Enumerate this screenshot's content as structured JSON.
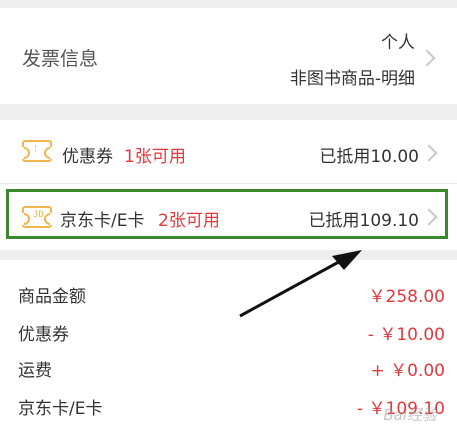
{
  "invoice": {
    "label": "发票信息",
    "type": "个人",
    "detail": "非图书商品-明细"
  },
  "coupon": {
    "label": "优惠券",
    "available": "1张可用",
    "value": "已抵用10.00"
  },
  "card": {
    "icon_text": "JD",
    "label": "京东卡/E卡",
    "available": "2张可用",
    "value": "已抵用109.10"
  },
  "summary": {
    "lines": [
      {
        "label": "商品金额",
        "value": "￥258.00"
      },
      {
        "label": "优惠券",
        "value": "- ￥10.00"
      },
      {
        "label": "运费",
        "value": "+ ￥0.00"
      },
      {
        "label": "京东卡/E卡",
        "value": "- ￥109.10"
      }
    ]
  },
  "colors": {
    "accent_red": "#e4393c",
    "ticket_gold": "#f1b54b",
    "highlight_green": "#3a8a2c"
  },
  "watermark": "Bai经验"
}
